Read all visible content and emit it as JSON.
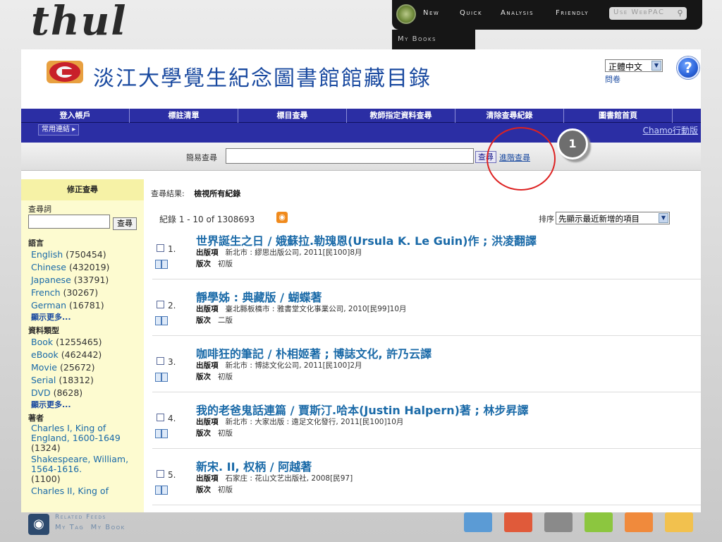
{
  "brand": "thul",
  "top_nav": {
    "items": [
      "New",
      "Quick",
      "Analysis",
      "Friendly"
    ],
    "webpac_placeholder": "Use WebPAC",
    "mybooks_tab": "My Books"
  },
  "header": {
    "title": "淡江大學覺生紀念圖書館館藏目錄",
    "language": "正體中文",
    "survey": "問卷",
    "help": "?"
  },
  "main_nav": {
    "items": [
      "登入帳戶",
      "標註清單",
      "標目查尋",
      "教師指定資料查尋",
      "清除查尋紀錄",
      "圖書館首頁"
    ],
    "common_links": "常用連結",
    "chamo": "Chamo行動版"
  },
  "search": {
    "label": "簡易查尋",
    "value": "",
    "button": "查尋",
    "advanced": "進階查尋"
  },
  "sidebar": {
    "title": "修正查尋",
    "query_label": "查尋詞",
    "query_value": "",
    "button": "查尋",
    "facets": [
      {
        "heading": "語言",
        "items": [
          {
            "label": "English",
            "count": "(750454)"
          },
          {
            "label": "Chinese",
            "count": "(432019)"
          },
          {
            "label": "Japanese",
            "count": "(33791)"
          },
          {
            "label": "French",
            "count": "(30267)"
          },
          {
            "label": "German",
            "count": "(16781)"
          }
        ],
        "more": "顯示更多..."
      },
      {
        "heading": "資料類型",
        "items": [
          {
            "label": "Book",
            "count": "(1255465)"
          },
          {
            "label": "eBook",
            "count": "(462442)"
          },
          {
            "label": "Movie",
            "count": "(25672)"
          },
          {
            "label": "Serial",
            "count": "(18312)"
          },
          {
            "label": "DVD",
            "count": "(8628)"
          }
        ],
        "more": "顯示更多..."
      },
      {
        "heading": "著者",
        "items": [
          {
            "label": "Charles I, King of England, 1600-1649",
            "count": "(1324)"
          },
          {
            "label": "Shakespeare, William, 1564-1616.",
            "count": "(1100)"
          },
          {
            "label": "Charles II, King of",
            "count": ""
          }
        ],
        "more": ""
      }
    ]
  },
  "results": {
    "summary_label": "查尋結果:",
    "summary_value": "檢視所有紀錄",
    "counter": "紀錄 1 - 10 of 1308693",
    "sort_label": "排序",
    "sort_value": "先顯示最近新增的項目",
    "pub_label": "出版項",
    "edition_label": "版次",
    "records": [
      {
        "num": "1.",
        "title": "世界誕生之日 / 娥蘇拉.勒瑰恩(Ursula K. Le Guin)作 ; 洪凌翻譯",
        "publisher": "新北市 : 繆思出版公司, 2011[民100]8月",
        "edition": "初版"
      },
      {
        "num": "2.",
        "title": "靜學姊 : 典藏版 / 蝴蝶著",
        "publisher": "臺北縣板橋市 : 雅書堂文化事業公司, 2010[民99]10月",
        "edition": "二版"
      },
      {
        "num": "3.",
        "title": "咖啡狂的筆記 / 朴相姬著 ; 博誌文化, 許乃云譯",
        "publisher": "新北市 : 博誌文化公司, 2011[民100]2月",
        "edition": "初版"
      },
      {
        "num": "4.",
        "title": "我的老爸鬼話連篇 / 賈斯汀.哈本(Justin Halpern)著 ; 林步昇譯",
        "publisher": "新北市 : 大家出版 : 遠足文化發行, 2011[民100]10月",
        "edition": "初版"
      },
      {
        "num": "5.",
        "title": "新宋. II, 权柄 / 阿越著",
        "publisher": "石家庄 : 花山文艺出版社, 2008[民97]",
        "edition": "初版"
      }
    ]
  },
  "annotation": {
    "badge": "1"
  },
  "footer": {
    "related_feeds": "Related Feeds",
    "my_tag": "My Tag",
    "my_book": "My Book",
    "swatches": [
      "#5b9bd5",
      "#e05a3a",
      "#8a8a8a",
      "#8cc63f",
      "#f08a3c",
      "#f2c14e"
    ]
  }
}
